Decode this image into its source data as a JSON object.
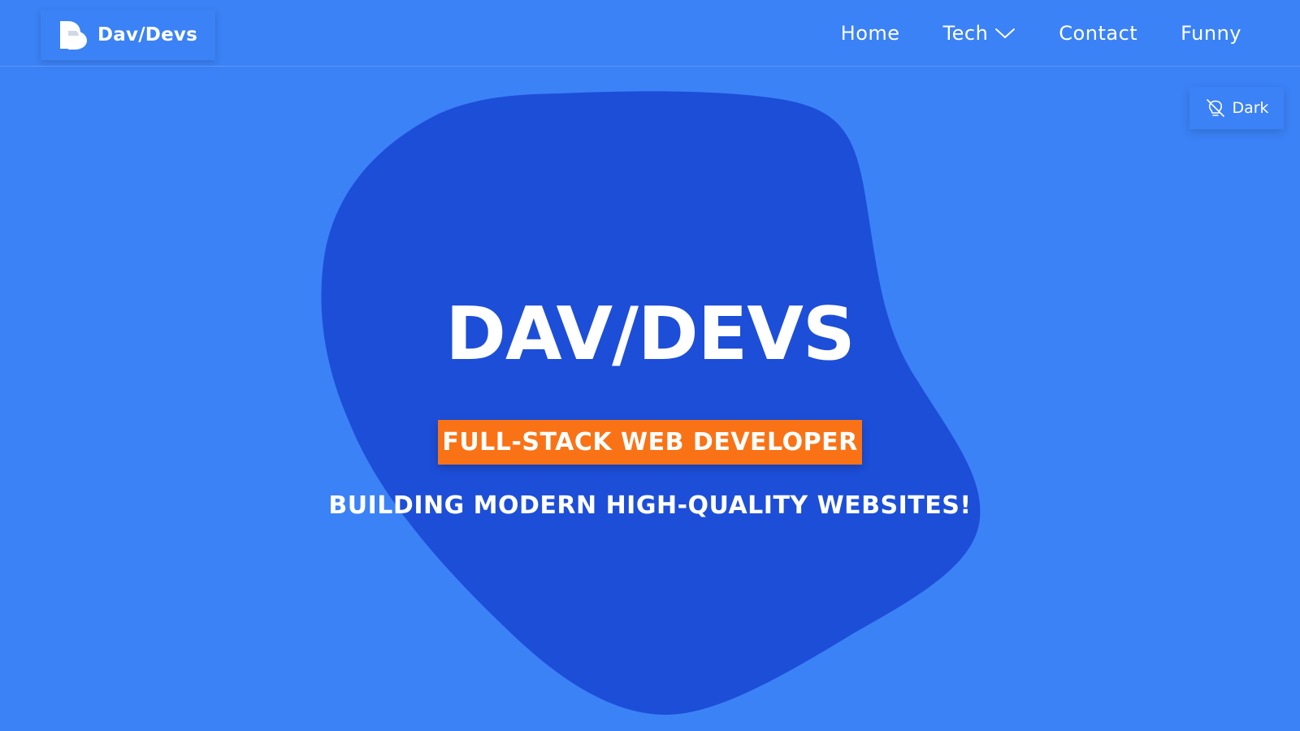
{
  "colors": {
    "background": "#3b82f6",
    "blob": "#1d4ed8",
    "badge": "#f97316",
    "text": "#ffffff"
  },
  "navbar": {
    "brand_name": "Dav/Devs",
    "brand_icon": "d-logo-icon",
    "links": [
      {
        "label": "Home"
      },
      {
        "label": "Tech",
        "icon": "chevron-down-icon"
      },
      {
        "label": "Contact"
      },
      {
        "label": "Funny"
      }
    ]
  },
  "theme_toggle": {
    "label": "Dark",
    "icon": "bulb-off-icon"
  },
  "hero": {
    "title": "DAV/DEVS",
    "badge": "FULL-STACK WEB DEVELOPER",
    "tagline": "BUILDING MODERN HIGH-QUALITY WEBSITES!"
  }
}
